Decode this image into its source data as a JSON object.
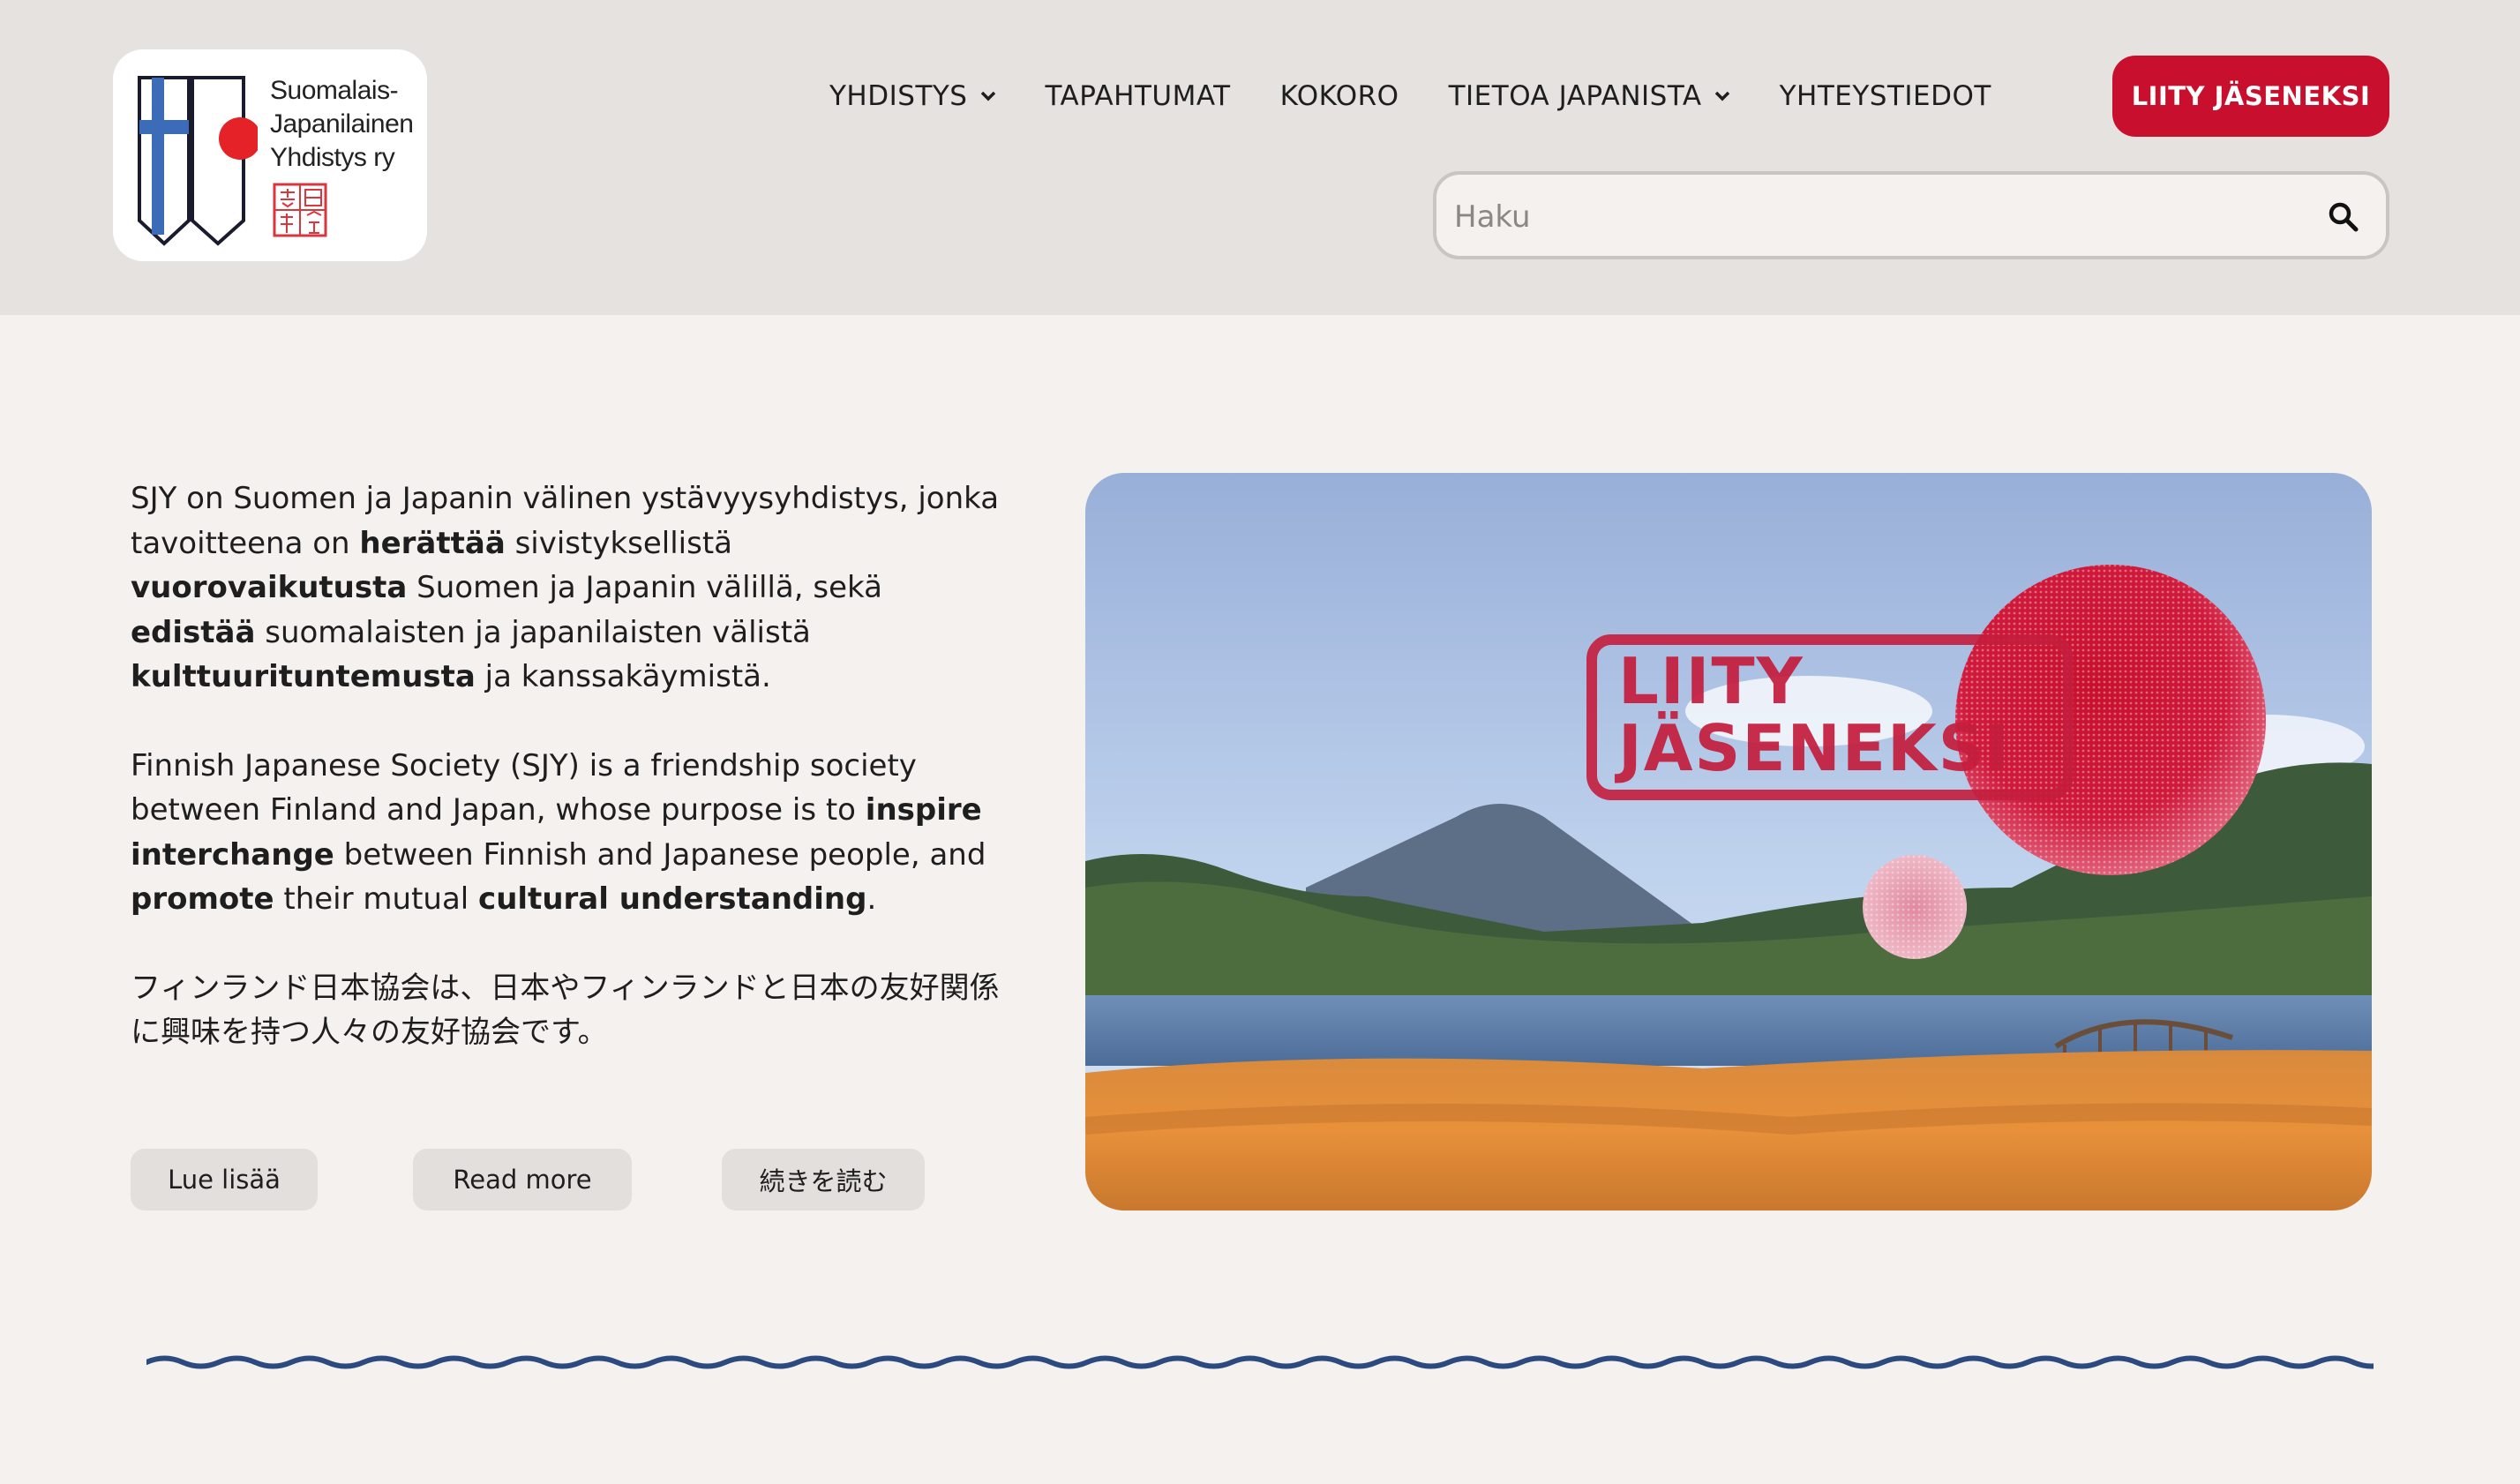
{
  "header": {
    "logo": {
      "text_lines": [
        "Suomalais-",
        "Japanilainen",
        "Yhdistys ry"
      ],
      "seal_text": "芬日協会"
    },
    "nav": [
      {
        "label": "YHDISTYS",
        "has_dropdown": true
      },
      {
        "label": "TAPAHTUMAT",
        "has_dropdown": false
      },
      {
        "label": "KOKORO",
        "has_dropdown": false
      },
      {
        "label": "TIETOA JAPANISTA",
        "has_dropdown": true
      },
      {
        "label": "YHTEYSTIEDOT",
        "has_dropdown": false
      }
    ],
    "join_button": "LIITY JÄSENEKSI",
    "search": {
      "placeholder": "Haku",
      "value": ""
    }
  },
  "intro": {
    "fi": {
      "t1": "SJY on Suomen ja Japanin välinen ystävyysyhdistys, jonka tavoitteena on ",
      "b1": "herättää",
      "t2": " sivistyksellistä ",
      "b2": "vuorovaikutusta",
      "t3": " Suomen ja Japanin välillä, sekä ",
      "b3": "edistää",
      "t4": " suomalaisten ja japanilaisten välistä ",
      "b4": "kulttuurituntemusta",
      "t5": " ja kanssakäymistä."
    },
    "en": {
      "t1": "Finnish Japanese Society (SJY) is a friendship society between Finland and Japan, whose purpose is to ",
      "b1": "inspire interchange",
      "t2": " between Finnish and Japanese people, and ",
      "b2": "promote",
      "t3": " their mutual ",
      "b3": "cultural understanding",
      "t4": "."
    },
    "ja": "フィンランド日本協会は、日本やフィンランドと日本の友好関係に興味を持つ人々の友好協会です。"
  },
  "buttons": {
    "read_more_fi": "Lue lisää",
    "read_more_en": "Read more",
    "read_more_ja": "続きを読む"
  },
  "banner": {
    "line1": "LIITY",
    "line2": "JÄSENEKSI"
  },
  "colors": {
    "accent_red": "#c8102e",
    "header_bg": "#e5e2e0",
    "page_bg": "#f5f1ee",
    "wave_blue": "#2a4a80",
    "button_bg": "#e2dfdc"
  }
}
